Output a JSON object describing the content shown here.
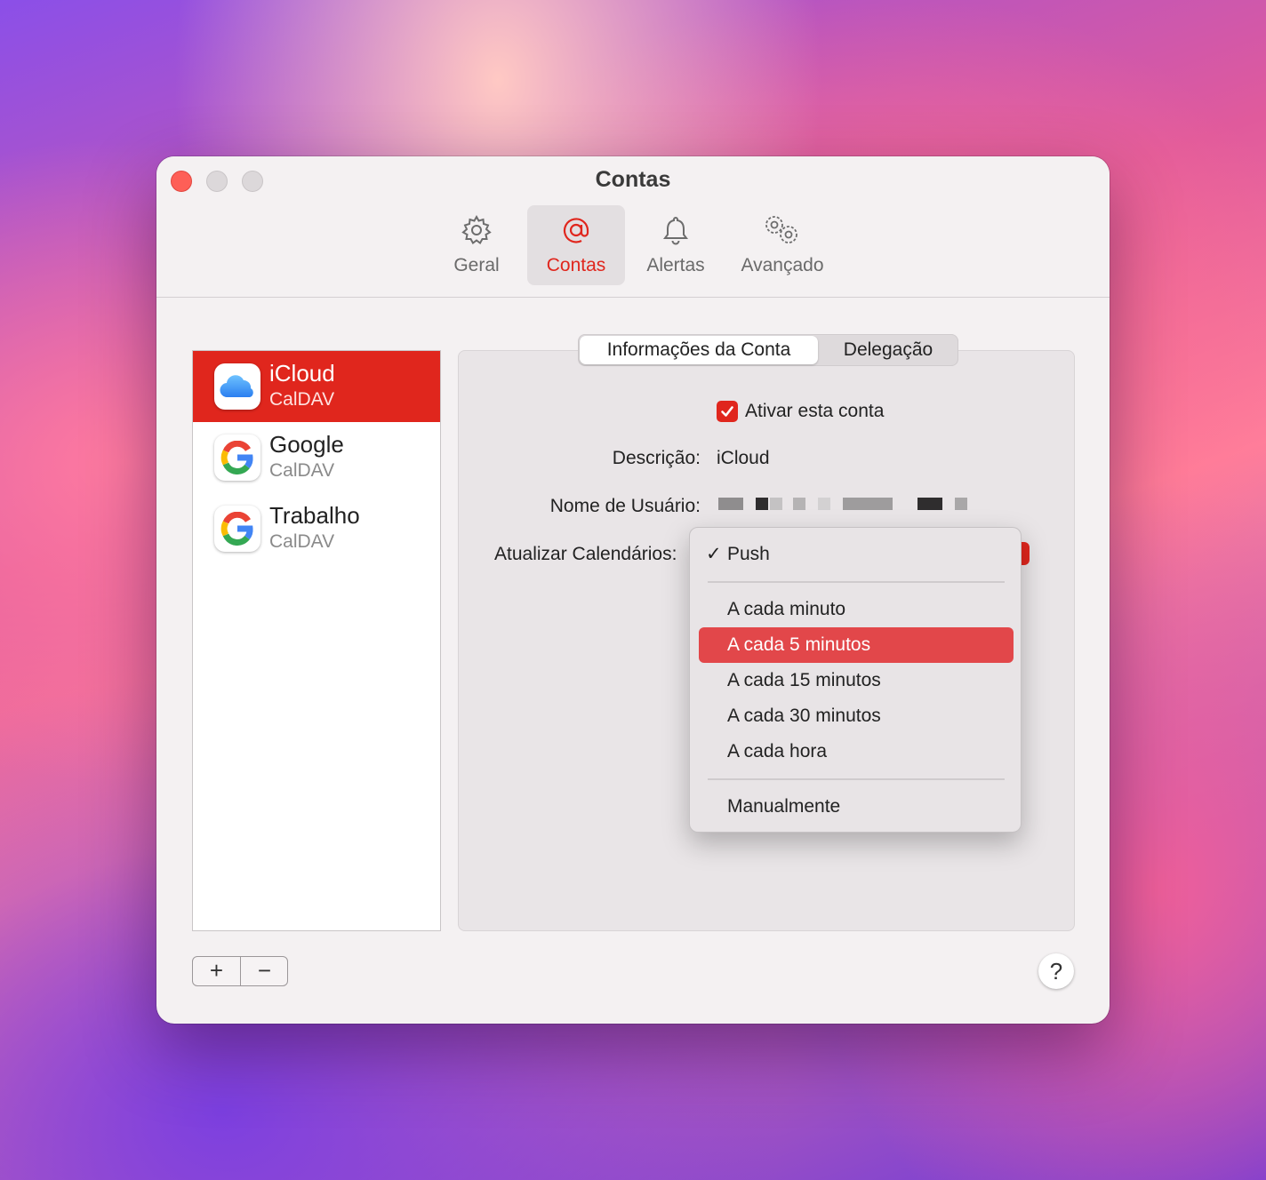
{
  "window": {
    "title": "Contas"
  },
  "toolbar": {
    "items": [
      {
        "label": "Geral",
        "icon": "gear-icon"
      },
      {
        "label": "Contas",
        "icon": "at-sign-icon",
        "active": true
      },
      {
        "label": "Alertas",
        "icon": "bell-icon"
      },
      {
        "label": "Avançado",
        "icon": "gears-icon"
      }
    ]
  },
  "accounts": [
    {
      "name": "iCloud",
      "type": "CalDAV",
      "icon": "icloud-icon",
      "selected": true
    },
    {
      "name": "Google",
      "type": "CalDAV",
      "icon": "google-icon"
    },
    {
      "name": "Trabalho",
      "type": "CalDAV",
      "icon": "google-icon"
    }
  ],
  "tabs": {
    "info": "Informações da Conta",
    "delegation": "Delegação"
  },
  "form": {
    "enable_label": "Ativar esta conta",
    "enable_checked": true,
    "description_label": "Descrição:",
    "description_value": "iCloud",
    "username_label": "Nome de Usuário:",
    "refresh_label": "Atualizar Calendários:"
  },
  "refresh_menu": {
    "checkmark": "✓",
    "items": [
      "Push",
      "A cada minuto",
      "A cada 5 minutos",
      "A cada 15 minutos",
      "A cada 30 minutos",
      "A cada hora",
      "Manualmente"
    ],
    "selected": "Push",
    "highlighted": "A cada 5 minutos"
  },
  "bottom": {
    "add": "+",
    "remove": "−",
    "help": "?"
  },
  "colors": {
    "accent": "#e0261d",
    "highlight": "#e2474a"
  }
}
